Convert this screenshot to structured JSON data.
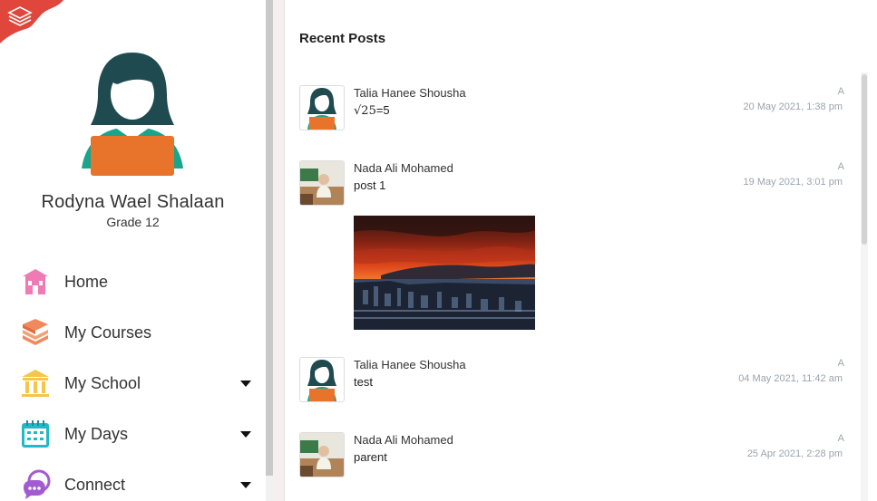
{
  "profile": {
    "name": "Rodyna Wael Shalaan",
    "grade": "Grade 12"
  },
  "nav": {
    "items": [
      {
        "label": "Home",
        "icon": "home-school-icon",
        "has_dropdown": false
      },
      {
        "label": "My Courses",
        "icon": "books-icon",
        "has_dropdown": false
      },
      {
        "label": "My School",
        "icon": "school-building-icon",
        "has_dropdown": true
      },
      {
        "label": "My Days",
        "icon": "calendar-icon",
        "has_dropdown": true
      },
      {
        "label": "Connect",
        "icon": "chat-bubble-icon",
        "has_dropdown": true
      }
    ]
  },
  "main": {
    "section_title": "Recent Posts",
    "posts": [
      {
        "author": "Talia Hanee Shousha",
        "text_prefix": "√",
        "text_radicand": "25",
        "text_suffix": "=5",
        "badge": "A",
        "date": "20 May 2021, 1:38 pm"
      },
      {
        "author": "Nada Ali Mohamed",
        "text": "post 1",
        "badge": "A",
        "date": "19 May 2021, 3:01 pm"
      },
      {
        "author": "Talia Hanee Shousha",
        "text": "test",
        "badge": "A",
        "date": "04 May 2021, 11:42 am"
      },
      {
        "author": "Nada Ali Mohamed",
        "text": "parent",
        "badge": "A",
        "date": "25 Apr 2021, 2:28 pm"
      }
    ]
  },
  "colors": {
    "accent_orange": "#e8732a",
    "hair_teal": "#1f4a50",
    "meta_gray": "#9aa4ae",
    "logo_red": "#e0463c"
  }
}
